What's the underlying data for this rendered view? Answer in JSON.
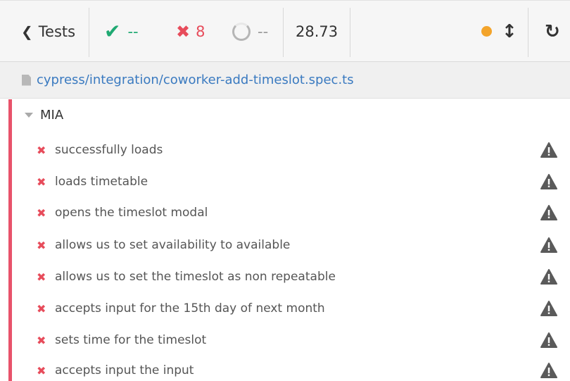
{
  "header": {
    "tests_label": "Tests",
    "passed": "--",
    "failed": "8",
    "pending": "--",
    "duration": "28.73"
  },
  "spec": {
    "path": "cypress/integration/coworker-add-timeslot.spec.ts"
  },
  "suite": {
    "title": "MIA",
    "tests": [
      {
        "title": "successfully loads"
      },
      {
        "title": "loads timetable"
      },
      {
        "title": "opens the timeslot modal"
      },
      {
        "title": "allows us to set availability to available"
      },
      {
        "title": "allows us to set the timeslot as non repeatable"
      },
      {
        "title": "accepts input for the 15th day of next month"
      },
      {
        "title": "sets time for the timeslot"
      },
      {
        "title": "accepts input the input"
      }
    ]
  },
  "colors": {
    "pass": "#1fa972",
    "fail": "#e74c5b",
    "running_dot": "#f3a42b",
    "link": "#3a7ac0"
  },
  "icons": [
    "chevron-left-icon",
    "check-icon",
    "x-icon",
    "spinner-icon",
    "status-dot-icon",
    "scroll-arrows-icon",
    "reload-icon",
    "file-icon",
    "caret-down-icon",
    "warning-icon"
  ]
}
